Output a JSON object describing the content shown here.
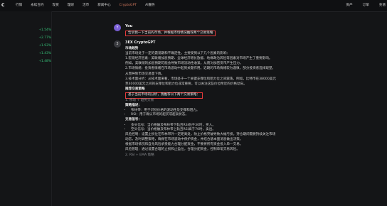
{
  "brand": {
    "logo": "C"
  },
  "nav": {
    "items": [
      "行情",
      "永续合约",
      "现货",
      "理财",
      "活币",
      "新闻中心",
      "CryptoGPT",
      "AI服务"
    ]
  },
  "right_nav": {
    "items": [
      "资产",
      "订单",
      "充值"
    ]
  },
  "sidebar": {
    "rows": [
      {
        "name": "",
        "change": "+1.54%"
      },
      {
        "name": "",
        "change": "+2.77%"
      },
      {
        "name": "",
        "change": "+1.93%"
      },
      {
        "name": "",
        "change": "+1.43%"
      },
      {
        "name": "",
        "change": "+1.48%"
      }
    ]
  },
  "chat": {
    "user": {
      "avatar": "Y",
      "name": "You",
      "text": "告诉我一下当前的市场，并根据市场情况推荐两个交易策略"
    },
    "bot": {
      "avatar": "3",
      "name": "3EX CryptoGPT",
      "section1_title": "市场趋势",
      "para1": "当前市场处于一定的震荡期和不确定性。主要受到以下几个因素的影响：",
      "para2": "1.宏观经济因素：美联储加息预期、全球经济增长放缓、地缘政治风险等因素对市场产生了重要影响。",
      "para3": "例如，美联储的加息预期可能会导致市场流动性收紧，从而对加密货币产生压力。",
      "para4": "2.市场情绪：投资者情绪在市场波动中起到关键作用。近期的市场情绪较为谨慎，部分投资者选择观望，",
      "para5": "从而导致市场交易量下降。",
      "para6": "3.技术面分析：从技术面来看，市场处于一个关键支撑位和阻力位之间震荡。例如，比特币在38000美元",
      "para7": "至40000美元之间的支撑位和阻力位非常重要，可以关注这些价位附近的价格动向。",
      "section2_title": "推荐交易策略",
      "boxed_text": "基于当前市场的分析，我推荐以下两个交易策略：",
      "strategy1": "1. 移动 + 趋势交易",
      "s1_title": "策略描述：",
      "s1_items": [
        "布林带：用于识别价格的波动性及支撑和阻力。",
        "RSI：用于确认市场的超买或超卖状态。"
      ],
      "entry_title": "交易信号：",
      "entry_items": [
        "多头信号：当价格触及布林带下轨且RSI低于30时，买入。",
        "空头信号：当价格触及布林带上轨且RSI高于70时，卖出。"
      ],
      "risk_line1": "风险控制：设置止损位在布林带外一定距离处，防止价格突破导致大幅亏损。持仓期间需要持续关注市场",
      "risk_line2": "动态，及时调整策略，确保在市场波动中保护资金，并结合基本面消息做出决策。",
      "risk_line3": "根据市场情况和自身风险承受能力合理分配资金，不要将所有资金投入单一交易。",
      "risk_line4": "风险管理：通过设置合理的止损和止盈位，合理分配资金，控制单笔交易风险。",
      "strategy2": "2. RSI + EMA 策略"
    }
  }
}
